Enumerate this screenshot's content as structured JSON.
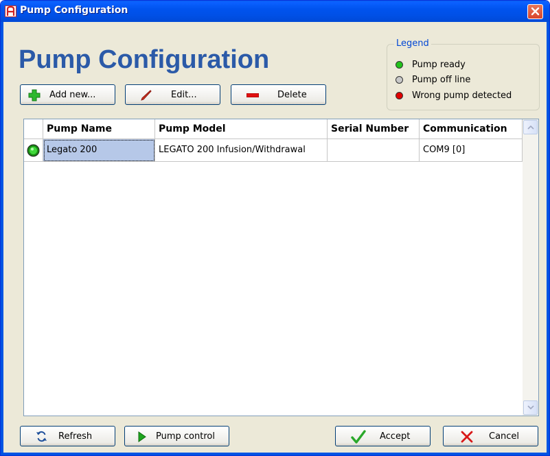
{
  "window": {
    "title": "Pump Configuration",
    "app_icon": "app-letter-a-icon",
    "close_icon": "close-icon"
  },
  "page": {
    "heading": "Pump Configuration"
  },
  "toolbar": {
    "add_label": "Add new...",
    "edit_label": "Edit...",
    "delete_label": "Delete"
  },
  "legend": {
    "title": "Legend",
    "items": [
      {
        "label": "Pump ready",
        "color": "#22c21a"
      },
      {
        "label": "Pump off line",
        "color": "#c8c8c8"
      },
      {
        "label": "Wrong pump detected",
        "color": "#e00000"
      }
    ]
  },
  "table": {
    "columns": [
      "",
      "Pump Name",
      "Pump Model",
      "Serial Number",
      "Communication"
    ],
    "rows": [
      {
        "status": "ready",
        "status_color": "#22c21a",
        "name": "Legato 200",
        "model": "LEGATO 200 Infusion/Withdrawal",
        "serial": "",
        "communication": "COM9 [0]"
      }
    ]
  },
  "footer": {
    "refresh_label": "Refresh",
    "pump_control_label": "Pump control",
    "accept_label": "Accept",
    "cancel_label": "Cancel"
  },
  "colors": {
    "titlebar": "#0054e3",
    "heading": "#2b5aa8",
    "legend_title": "#0046d5",
    "selection": "#b6c8e8"
  }
}
